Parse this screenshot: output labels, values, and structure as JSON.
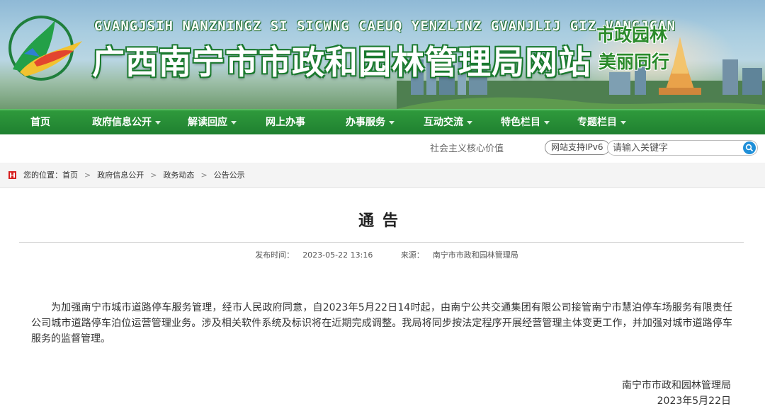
{
  "banner": {
    "pinyin": "GVANGJSIH NANZNINGZ SI SICWNG CAEUQ YENZLINZ GVANJLIJ GIZ VANGJCAN",
    "site_title": "广西南宁市市政和园林管理局网站",
    "slogan_line1": "市政园林",
    "slogan_line2": "美丽同行"
  },
  "nav": {
    "items": [
      {
        "label": "首页",
        "has_menu": false
      },
      {
        "label": "政府信息公开",
        "has_menu": true
      },
      {
        "label": "解读回应",
        "has_menu": true
      },
      {
        "label": "网上办事",
        "has_menu": false
      },
      {
        "label": "办事服务",
        "has_menu": true
      },
      {
        "label": "互动交流",
        "has_menu": true
      },
      {
        "label": "特色栏目",
        "has_menu": true
      },
      {
        "label": "专题栏目",
        "has_menu": true
      }
    ]
  },
  "toolbar": {
    "marquee_text": "社会主义核心价值",
    "ipv6_label": "网站支持IPv6",
    "search_placeholder": "请输入关键字"
  },
  "breadcrumb": {
    "prefix": "您的位置：",
    "items": [
      "首页",
      "政府信息公开",
      "政务动态",
      "公告公示"
    ]
  },
  "article": {
    "title": "通告",
    "publish_time_label": "发布时间：",
    "publish_time": "2023-05-22 13:16",
    "source_label": "来源：",
    "source": "南宁市市政和园林管理局",
    "body": "为加强南宁市城市道路停车服务管理，经市人民政府同意，自2023年5月22日14时起，由南宁公共交通集团有限公司接管南宁市慧泊停车场服务有限责任公司城市道路停车泊位运营管理业务。涉及相关软件系统及标识将在近期完成调整。我局将同步按法定程序开展经营管理主体变更工作，并加强对城市道路停车服务的监督管理。",
    "signature": "南宁市市政和园林管理局",
    "date": "2023年5月22日"
  },
  "colors": {
    "nav_green": "#1f8030",
    "title_green": "#1b7a2f",
    "slogan_green": "#2a8a2a",
    "home_mark_red": "#d62020",
    "search_button_blue": "#1f8fd8"
  }
}
